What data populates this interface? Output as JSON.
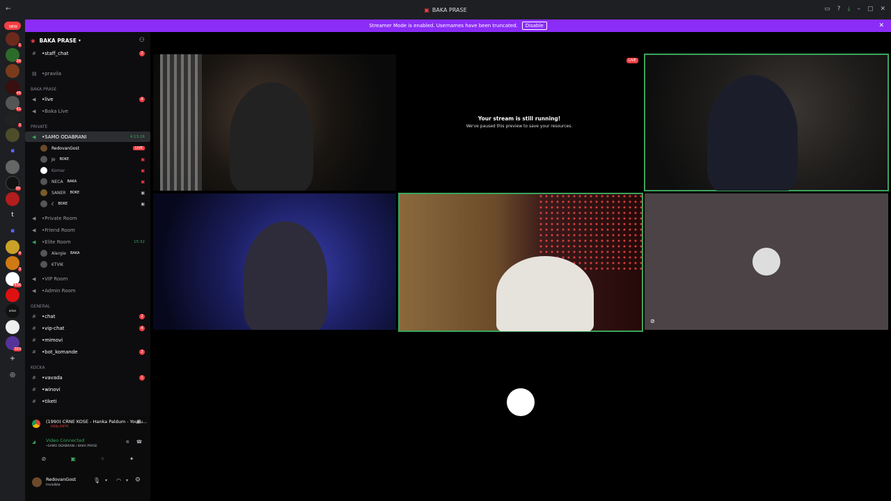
{
  "window": {
    "title": "BAKA PRASE"
  },
  "banner": {
    "text": "Streamer Mode is enabled. Usernames have been truncated.",
    "button": "Disable"
  },
  "server": {
    "name": "BAKA PRASE"
  },
  "channels_top": [
    {
      "name": "•staff_chat",
      "badge": "2"
    },
    {
      "name": "•pravila",
      "badge": ""
    }
  ],
  "cat_baka": "BAKA PRASE",
  "baka_channels": [
    {
      "name": "•live",
      "badge": "4"
    },
    {
      "name": "•Baka Live",
      "badge": ""
    }
  ],
  "cat_private": "PRIVATE",
  "voice_main": {
    "name": "•SAMO ODABRANI",
    "time": "4:13:26"
  },
  "voice_users": [
    {
      "name": "RedovanGost",
      "tag": "",
      "live": "LIVE"
    },
    {
      "name": "Jo",
      "tag": "BOKE",
      "live": ""
    },
    {
      "name": "Komar",
      "tag": "",
      "live": ""
    },
    {
      "name": "NECA",
      "tag": "BAKA",
      "live": ""
    },
    {
      "name": "SANER",
      "tag": "BOKE",
      "live": ""
    },
    {
      "name": "ć",
      "tag": "BOKE",
      "live": ""
    }
  ],
  "voice_rooms": [
    {
      "name": "•Private Room"
    },
    {
      "name": "•Friend Room"
    },
    {
      "name": "•Elite Room",
      "time": "15:32"
    }
  ],
  "elite_users": [
    {
      "name": "Alergie",
      "tag": "BAKA"
    },
    {
      "name": "€TVI€",
      "tag": ""
    }
  ],
  "voice_rooms_2": [
    {
      "name": "•VIP Room"
    },
    {
      "name": "•Admin Room"
    }
  ],
  "cat_general": "GENERAL",
  "general_channels": [
    {
      "name": "•chat",
      "badge": "2"
    },
    {
      "name": "•vip-chat",
      "badge": "4"
    },
    {
      "name": "•mimovi",
      "badge": ""
    },
    {
      "name": "•bot_komande",
      "badge": "2"
    }
  ],
  "cat_kocka": "KOCKA",
  "kocka_channels": [
    {
      "name": "•vavada",
      "badge": "1"
    },
    {
      "name": "•winovi",
      "badge": ""
    },
    {
      "name": "•tiketi",
      "badge": ""
    }
  ],
  "activity": {
    "title": "(1990) CRNE KOSE - Hanka Paldum - YouTu...",
    "sub": "1440p 60FPS"
  },
  "voice_status": {
    "label": "Video Connected",
    "where": "•SAMO ODABRANI / BAKA PRASE"
  },
  "user": {
    "name": "RedovanGost",
    "status": "Invisible"
  },
  "stream": {
    "msg1": "Your stream is still running!",
    "msg2": "We've paused this preview to save your resources.",
    "live": "LIVE"
  },
  "rail_badges": [
    "NEW",
    "1",
    "24",
    "46",
    "41",
    "3",
    "",
    "",
    "30",
    "",
    "",
    "",
    "4",
    "3",
    "",
    "436",
    "",
    "",
    "",
    "303"
  ],
  "colors": {
    "accent": "#8b2cf7",
    "live": "#f23f43",
    "speaking": "#3ba55c"
  }
}
